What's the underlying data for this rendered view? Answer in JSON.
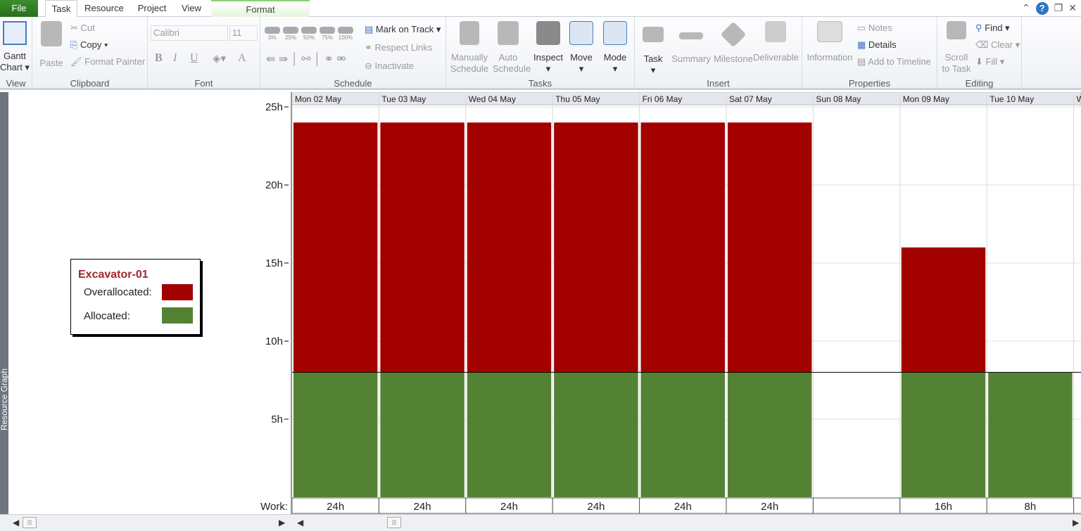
{
  "tabs": {
    "file": "File",
    "task": "Task",
    "resource": "Resource",
    "project": "Project",
    "view": "View",
    "format": "Format"
  },
  "ribbon": {
    "view": {
      "gantt": "Gantt",
      "chart": "Chart ▾",
      "label": "View"
    },
    "clipboard": {
      "paste": "Paste",
      "cut": "Cut",
      "copy": "Copy ▾",
      "format_painter": "Format Painter",
      "label": "Clipboard"
    },
    "font": {
      "family": "Calibri",
      "size": "11",
      "bold": "B",
      "italic": "I",
      "underline": "U",
      "color": "A",
      "label": "Font"
    },
    "schedule": {
      "percents": [
        "0%",
        "25%",
        "50%",
        "75%",
        "100%"
      ],
      "mark_on_track": "Mark on Track ▾",
      "respect_links": "Respect Links",
      "inactivate": "Inactivate",
      "label": "Schedule"
    },
    "tasks": {
      "manually": "Manually",
      "manually2": "Schedule",
      "auto": "Auto",
      "auto2": "Schedule",
      "inspect": "Inspect",
      "move": "Move",
      "mode": "Mode",
      "label": "Tasks"
    },
    "insert": {
      "task": "Task",
      "summary": "Summary",
      "milestone": "Milestone",
      "deliverable": "Deliverable",
      "label": "Insert"
    },
    "properties": {
      "information": "Information",
      "notes": "Notes",
      "details": "Details",
      "add_timeline": "Add to Timeline",
      "label": "Properties"
    },
    "editing": {
      "scroll": "Scroll",
      "scroll2": "to Task",
      "find": "Find ▾",
      "clear": "Clear ▾",
      "fill": "Fill ▾",
      "label": "Editing"
    }
  },
  "side_label": "Resource Graph",
  "legend": {
    "resource": "Excavator-01",
    "overallocated": "Overallocated:",
    "allocated": "Allocated:"
  },
  "colors": {
    "overallocated": "#a30000",
    "allocated": "#548235"
  },
  "chart_data": {
    "type": "bar",
    "stacked": true,
    "categories": [
      "Mon 02 May",
      "Tue 03 May",
      "Wed 04 May",
      "Thu 05 May",
      "Fri 06 May",
      "Sat 07 May",
      "Sun 08 May",
      "Mon 09 May",
      "Tue 10 May",
      "W"
    ],
    "series": [
      {
        "name": "Allocated",
        "values": [
          8,
          8,
          8,
          8,
          8,
          8,
          0,
          8,
          8,
          null
        ]
      },
      {
        "name": "Overallocated",
        "values": [
          16,
          16,
          16,
          16,
          16,
          16,
          0,
          8,
          0,
          null
        ]
      }
    ],
    "available": 8,
    "yticks": [
      "5h",
      "10h",
      "15h",
      "20h",
      "25h"
    ],
    "ylim": [
      0,
      25
    ],
    "work_label": "Work:",
    "work": [
      "24h",
      "24h",
      "24h",
      "24h",
      "24h",
      "24h",
      "",
      "16h",
      "8h",
      ""
    ]
  }
}
